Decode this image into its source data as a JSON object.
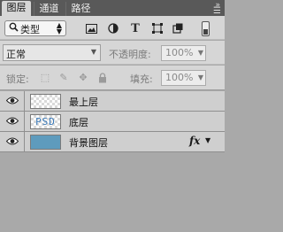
{
  "tabs": [
    {
      "label": "图层",
      "active": true
    },
    {
      "label": "通道",
      "active": false
    },
    {
      "label": "路径",
      "active": false
    }
  ],
  "filter": {
    "label": "类型",
    "icons": [
      "image-filter-icon",
      "adjustment-filter-icon",
      "type-filter-icon",
      "shape-filter-icon",
      "smart-object-filter-icon"
    ],
    "type_glyph": "T"
  },
  "blend_mode": "正常",
  "opacity": {
    "label": "不透明度:",
    "value": "100%"
  },
  "lock": {
    "label": "锁定:"
  },
  "fill": {
    "label": "填充:",
    "value": "100%"
  },
  "layers": [
    {
      "name": "最上层",
      "visible": true,
      "thumb": "transparent"
    },
    {
      "name": "底层",
      "visible": true,
      "thumb": "psd-text",
      "thumb_text": "PSD"
    },
    {
      "name": "背景图层",
      "visible": true,
      "thumb": "blue",
      "thumb_color": "#5e9bbd",
      "fx_label": "fx"
    }
  ],
  "colors": {
    "panel_bg": "#d6d6d6",
    "tab_bar": "#595959",
    "empty_area": "#a9a9a9"
  }
}
